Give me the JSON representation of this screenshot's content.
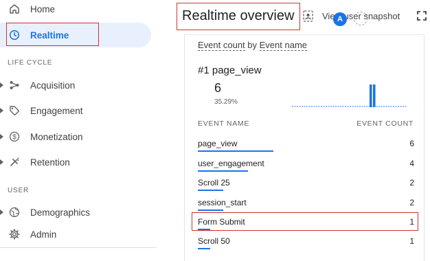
{
  "sidebar": {
    "home_label": "Home",
    "realtime_label": "Realtime",
    "lifecycle_section": "LIFE CYCLE",
    "lifecycle_items": [
      {
        "label": "Acquisition",
        "icon": "acquisition-icon"
      },
      {
        "label": "Engagement",
        "icon": "tag-icon"
      },
      {
        "label": "Monetization",
        "icon": "dollar-icon"
      },
      {
        "label": "Retention",
        "icon": "magnet-icon"
      }
    ],
    "user_section": "USER",
    "user_items": [
      {
        "label": "Demographics",
        "icon": "globe-icon"
      },
      {
        "label": "Admin",
        "icon": "gear-icon"
      }
    ]
  },
  "header": {
    "title": "Realtime overview",
    "snapshot_label": "View user snapshot",
    "avatar_letter": "A"
  },
  "card": {
    "metric": "Event count",
    "by": "by",
    "dimension": "Event name",
    "top_rank": "#1 page_view",
    "top_value": "6",
    "top_percent": "35.29%",
    "col_event_name": "EVENT NAME",
    "col_event_count": "EVENT COUNT",
    "rows": [
      {
        "name": "page_view",
        "count": "6"
      },
      {
        "name": "user_engagement",
        "count": "4"
      },
      {
        "name": "Scroll 25",
        "count": "2"
      },
      {
        "name": "session_start",
        "count": "2"
      },
      {
        "name": "Form Submit",
        "count": "1"
      },
      {
        "name": "Scroll 50",
        "count": "1"
      }
    ]
  },
  "colors": {
    "accent": "#1a73e8",
    "highlight_border": "#d32f2f",
    "selected_bg": "#e8f0fe"
  }
}
